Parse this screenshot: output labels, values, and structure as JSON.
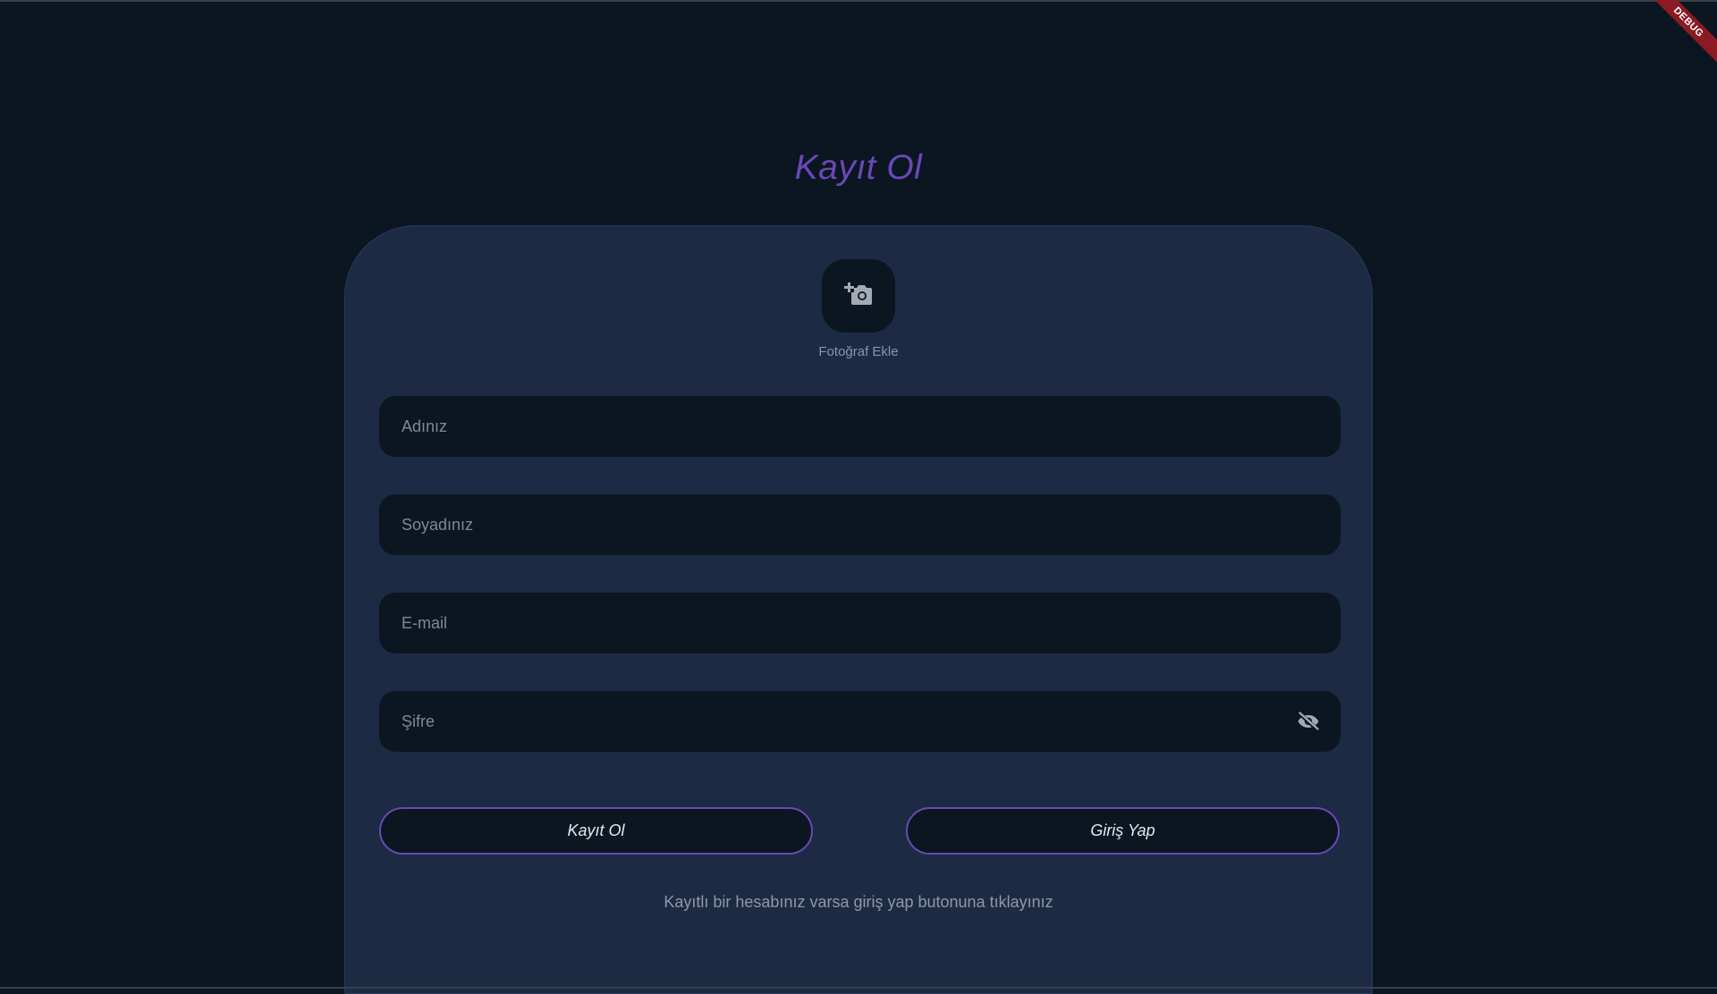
{
  "page": {
    "title": "Kayıt Ol",
    "debug_label": "DEBUG"
  },
  "photo": {
    "icon": "add-a-photo-icon",
    "label": "Fotoğraf Ekle"
  },
  "form": {
    "first_name": {
      "placeholder": "Adınız",
      "value": ""
    },
    "last_name": {
      "placeholder": "Soyadınız",
      "value": ""
    },
    "email": {
      "placeholder": "E-mail",
      "value": ""
    },
    "password": {
      "placeholder": "Şifre",
      "value": "",
      "toggle_icon": "visibility-off-icon"
    }
  },
  "actions": {
    "register_label": "Kayıt Ol",
    "login_label": "Giriş Yap"
  },
  "hint": "Kayıtlı bir hesabınız varsa giriş yap butonuna tıklayınız",
  "colors": {
    "background": "#0b1620",
    "card": "#1c2a44",
    "accent": "#6a48b8",
    "field": "#0b1620",
    "debug": "#8b1a22"
  }
}
